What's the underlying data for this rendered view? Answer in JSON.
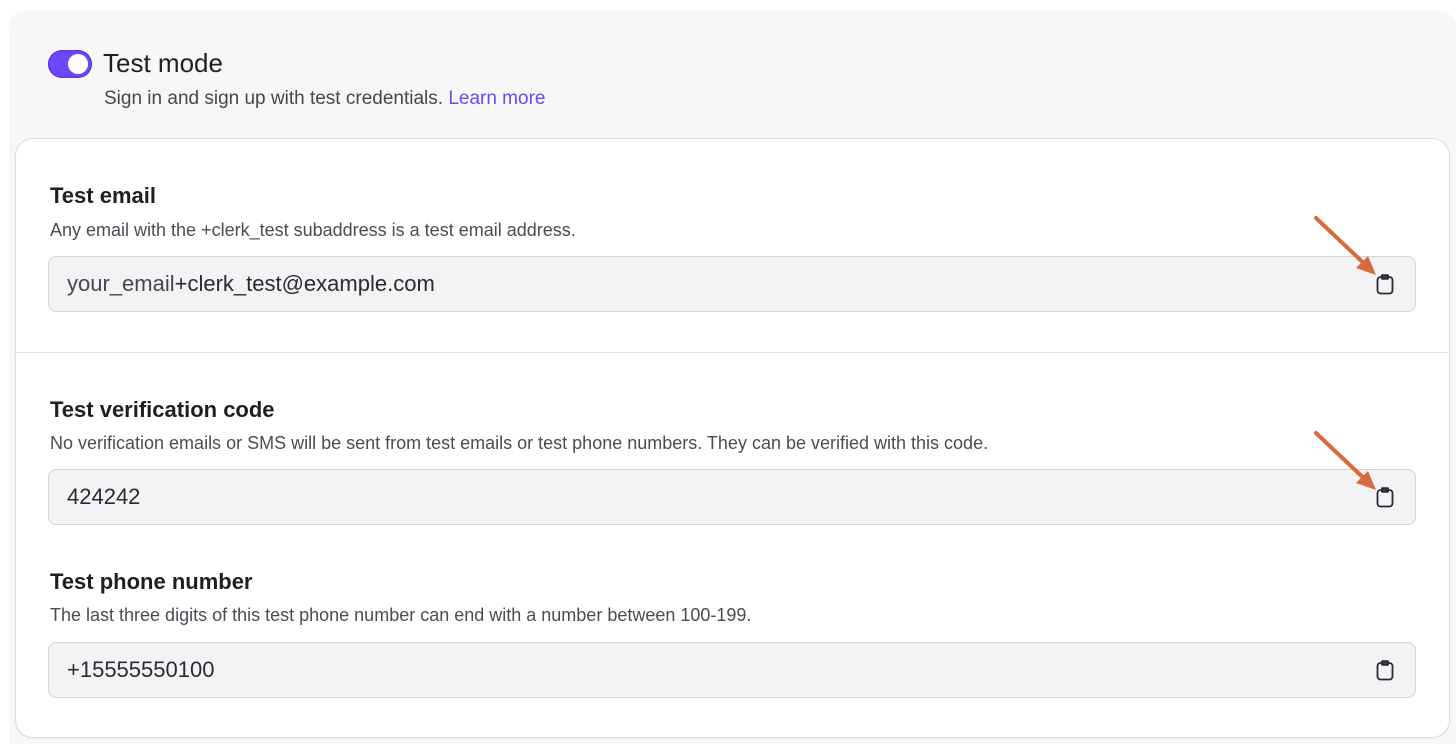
{
  "test_mode": {
    "title": "Test mode",
    "description": "Sign in and sign up with test credentials.",
    "learn_more_label": "Learn more",
    "enabled": true
  },
  "test_email": {
    "title": "Test email",
    "description": "Any email with the +clerk_test subaddress is a test email address.",
    "value_prefix": "your_email",
    "value_suffix": "+clerk_test@example.com"
  },
  "test_verification_code": {
    "title": "Test verification code",
    "description": "No verification emails or SMS will be sent from test emails or test phone numbers. They can be verified with this code.",
    "value": "424242"
  },
  "test_phone_number": {
    "title": "Test phone number",
    "description": "The last three digits of this test phone number can end with a number between 100-199.",
    "value": "+15555550100"
  },
  "colors": {
    "accent": "#6c47ff",
    "annotation_arrow": "#d9693f"
  },
  "icons": {
    "copy": "clipboard-icon",
    "annotation": "arrow-annotation"
  }
}
